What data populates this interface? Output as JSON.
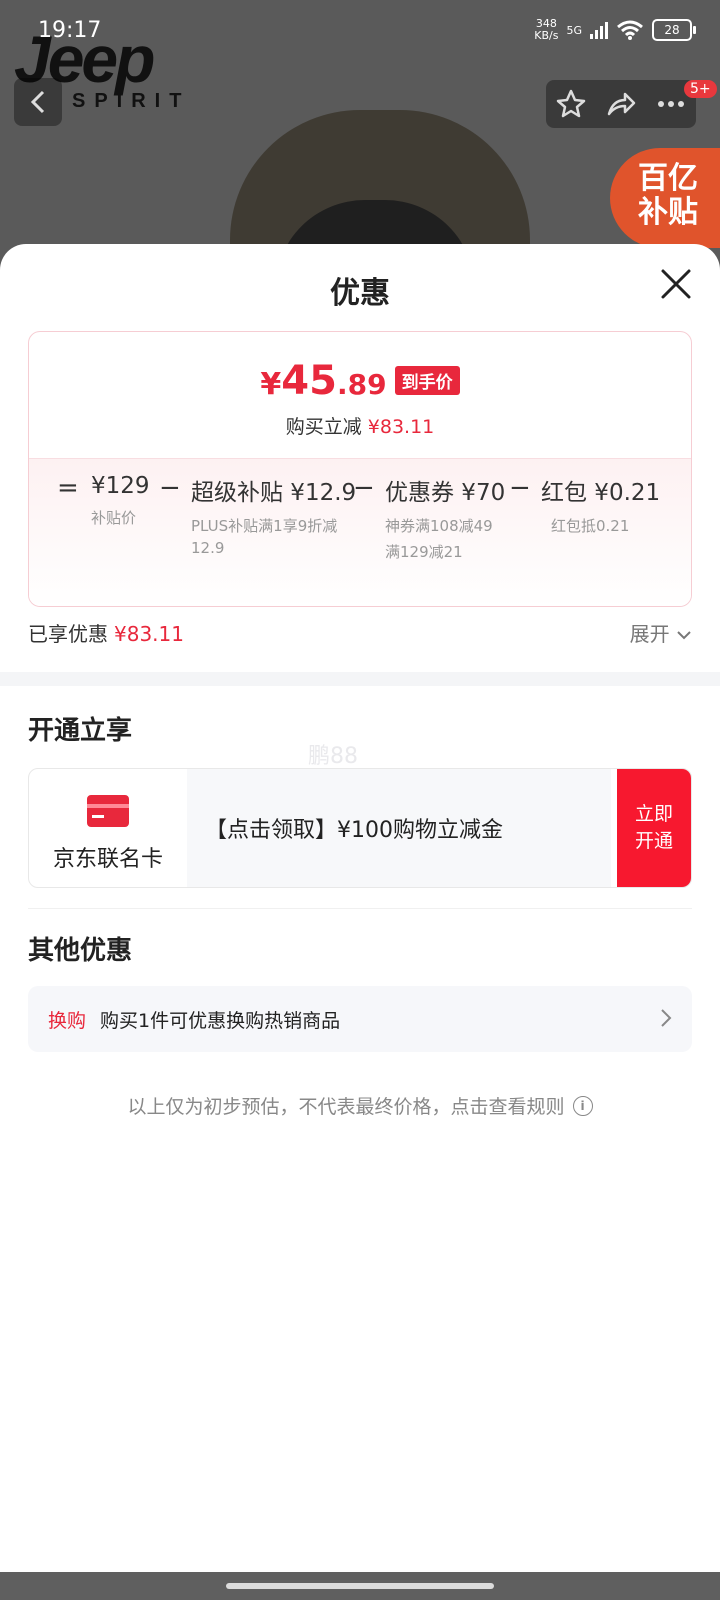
{
  "status_bar": {
    "time": "19:17",
    "net_speed_value": "348",
    "net_speed_unit": "KB/s",
    "net_type": "5G",
    "battery": "28"
  },
  "brand": {
    "name": "Jeep",
    "sub": "SPIRIT"
  },
  "top_actions": {
    "badge": "5+"
  },
  "subsidy_badge": {
    "line1": "百亿",
    "line2": "补贴"
  },
  "sheet": {
    "title": "优惠",
    "final_price": {
      "currency": "¥",
      "integer": "45",
      "decimal": ".89",
      "tag": "到手价"
    },
    "instant_cut": {
      "label": "购买立减",
      "value": "¥83.11"
    },
    "breakdown": {
      "op_equals": "=",
      "op_minus": "−",
      "items": [
        {
          "main": "¥129",
          "sub": [
            "补贴价"
          ]
        },
        {
          "main": "超级补贴 ¥12.9",
          "sub": [
            "PLUS补贴满1享9折减12.9"
          ]
        },
        {
          "main": "优惠券 ¥70",
          "sub": [
            "神券满108减49",
            "满129减21"
          ]
        },
        {
          "main": "红包 ¥0.21",
          "sub": [
            "红包抵0.21"
          ]
        }
      ]
    },
    "enjoyed": {
      "label": "已享优惠",
      "value": "¥83.11",
      "expand": "展开"
    },
    "open_section": {
      "title": "开通立享",
      "card_name": "京东联名卡",
      "offer_text": "【点击领取】¥100购物立减金",
      "cta_line1": "立即",
      "cta_line2": "开通"
    },
    "other_section": {
      "title": "其他优惠",
      "tag": "换购",
      "text": "购买1件可优惠换购热销商品"
    },
    "disclaimer": "以上仅为初步预估，不代表最终价格，点击查看规则",
    "watermark": "鹏88"
  },
  "colors": {
    "accent_red": "#e8283c",
    "cta_red": "#f7182f"
  }
}
